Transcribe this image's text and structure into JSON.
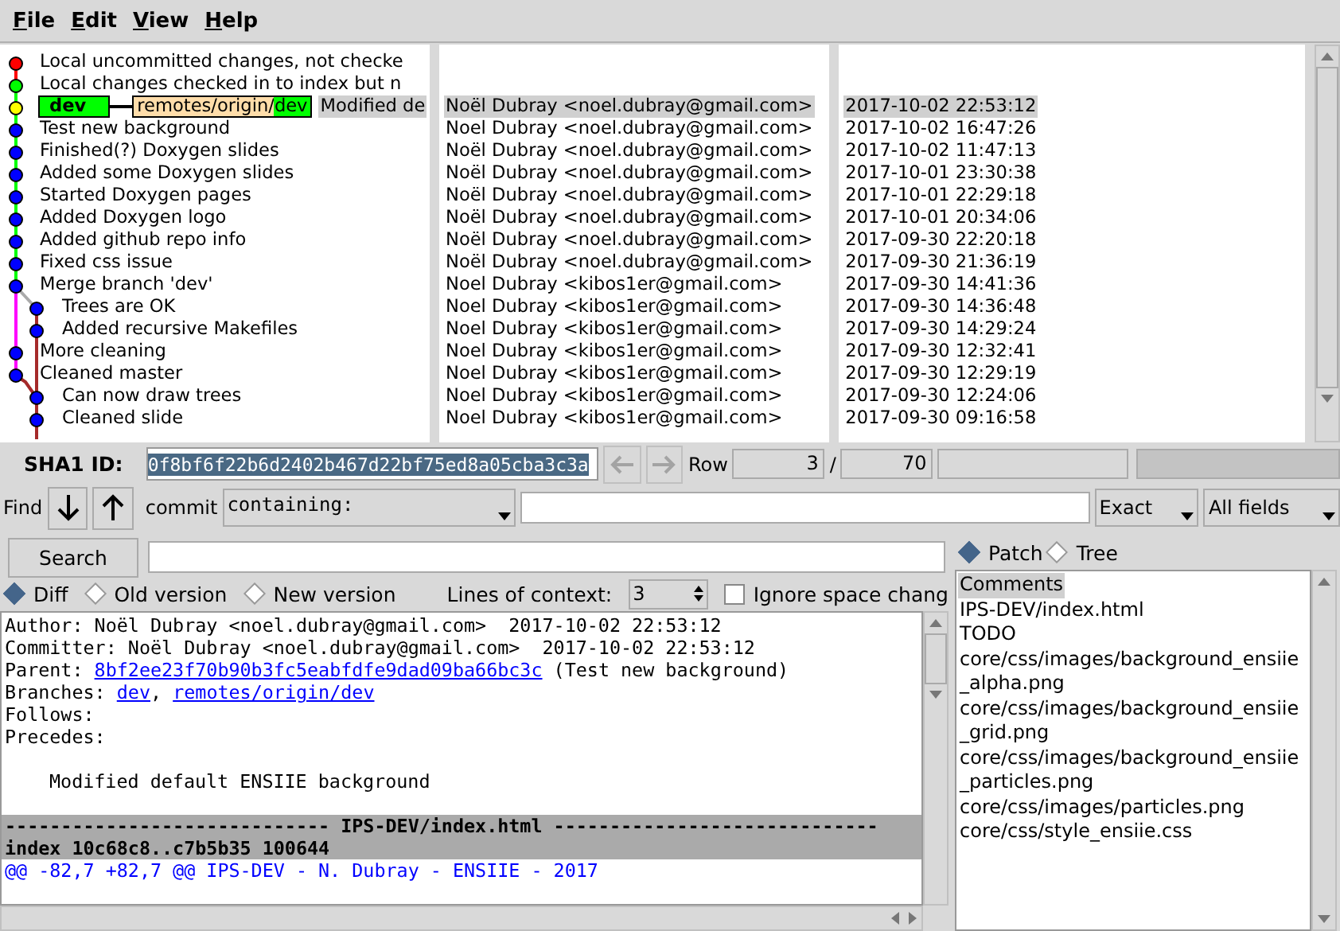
{
  "menu": [
    "File",
    "Edit",
    "View",
    "Help"
  ],
  "commits": [
    {
      "subject": "Local uncommitted changes, not checke",
      "color": "#ff0000",
      "kind": "main",
      "selected": false
    },
    {
      "subject": "Local changes checked in to index but n",
      "color": "#00ff00",
      "kind": "main",
      "selected": false
    },
    {
      "subject": "Modified de",
      "color": "#ffff00",
      "kind": "main",
      "selected": true,
      "refs": [
        {
          "kind": "local",
          "name": "dev"
        },
        {
          "kind": "remote",
          "prefix": "remotes/origin/",
          "name": "dev"
        }
      ],
      "author": "Noël Dubray <noel.dubray@gmail.com>",
      "date": "2017-10-02 22:53:12"
    },
    {
      "subject": "Test new background",
      "color": "#0000ff",
      "kind": "main",
      "selected": false,
      "author": "Noel Dubray <noel.dubray@gmail.com>",
      "date": "2017-10-02 16:47:26"
    },
    {
      "subject": "Finished(?) Doxygen slides",
      "color": "#0000ff",
      "kind": "main",
      "selected": false,
      "author": "Noël Dubray <noel.dubray@gmail.com>",
      "date": "2017-10-02 11:47:13"
    },
    {
      "subject": "Added some Doxygen slides",
      "color": "#0000ff",
      "kind": "main",
      "selected": false,
      "author": "Noël Dubray <noel.dubray@gmail.com>",
      "date": "2017-10-01 23:30:38"
    },
    {
      "subject": "Started Doxygen pages",
      "color": "#0000ff",
      "kind": "main",
      "selected": false,
      "author": "Noël Dubray <noel.dubray@gmail.com>",
      "date": "2017-10-01 22:29:18"
    },
    {
      "subject": "Added Doxygen logo",
      "color": "#0000ff",
      "kind": "main",
      "selected": false,
      "author": "Noël Dubray <noel.dubray@gmail.com>",
      "date": "2017-10-01 20:34:06"
    },
    {
      "subject": "Added github repo info",
      "color": "#0000ff",
      "kind": "main",
      "selected": false,
      "author": "Noël Dubray <noel.dubray@gmail.com>",
      "date": "2017-09-30 22:20:18"
    },
    {
      "subject": "Fixed css issue",
      "color": "#0000ff",
      "kind": "main",
      "selected": false,
      "author": "Noël Dubray <noel.dubray@gmail.com>",
      "date": "2017-09-30 21:36:19"
    },
    {
      "subject": "Merge branch 'dev'",
      "color": "#0000ff",
      "kind": "main",
      "selected": false,
      "author": "Noel Dubray <kibos1er@gmail.com>",
      "date": "2017-09-30 14:41:36"
    },
    {
      "subject": "Trees are OK",
      "color": "#0000ff",
      "kind": "side",
      "selected": false,
      "author": "Noel Dubray <kibos1er@gmail.com>",
      "date": "2017-09-30 14:36:48"
    },
    {
      "subject": "Added recursive Makefiles",
      "color": "#0000ff",
      "kind": "side",
      "selected": false,
      "author": "Noel Dubray <kibos1er@gmail.com>",
      "date": "2017-09-30 14:29:24"
    },
    {
      "subject": "More cleaning",
      "color": "#0000ff",
      "kind": "main",
      "selected": false,
      "author": "Noel Dubray <kibos1er@gmail.com>",
      "date": "2017-09-30 12:32:41"
    },
    {
      "subject": "Cleaned master",
      "color": "#0000ff",
      "kind": "main",
      "selected": false,
      "author": "Noel Dubray <kibos1er@gmail.com>",
      "date": "2017-09-30 12:29:19"
    },
    {
      "subject": "Can now draw trees",
      "color": "#0000ff",
      "kind": "side",
      "selected": false,
      "author": "Noel Dubray <kibos1er@gmail.com>",
      "date": "2017-09-30 12:24:06"
    },
    {
      "subject": "Cleaned slide",
      "color": "#0000ff",
      "kind": "side",
      "selected": false,
      "author": "Noel Dubray <kibos1er@gmail.com>",
      "date": "2017-09-30 09:16:58"
    }
  ],
  "sha_bar": {
    "label": "SHA1 ID:",
    "value": "0f8bf6f22b6d2402b467d22bf75ed8a05cba3c3a",
    "back_disabled": true,
    "forward_disabled": true,
    "row_label": "Row",
    "row": "3",
    "separator": "/",
    "total": "70"
  },
  "find": {
    "label": "Find",
    "type_label": "commit",
    "mode": "containing:",
    "match": "Exact",
    "fields": "All fields"
  },
  "search": {
    "button": "Search"
  },
  "diff_modes": [
    {
      "label": "Diff",
      "selected": true
    },
    {
      "label": "Old version",
      "selected": false
    },
    {
      "label": "New version",
      "selected": false
    }
  ],
  "context": {
    "label": "Lines of context:",
    "value": "3"
  },
  "ignore_space": {
    "label": "Ignore space chang",
    "checked": false
  },
  "details": [
    {
      "kind": "text",
      "parts": [
        {
          "text": "Author: Noël Dubray <noel.dubray@gmail.com>  2017-10-02 22:53:12"
        }
      ]
    },
    {
      "kind": "text",
      "parts": [
        {
          "text": "Committer: Noël Dubray <noel.dubray@gmail.com>  2017-10-02 22:53:12"
        }
      ]
    },
    {
      "kind": "text",
      "parts": [
        {
          "text": "Parent: "
        },
        {
          "link": "8bf2ee23f70b90b3fc5eabfdfe9dad09ba66bc3c"
        },
        {
          "text": " (Test new background)"
        }
      ]
    },
    {
      "kind": "text",
      "parts": [
        {
          "text": "Branches: "
        },
        {
          "link": "dev"
        },
        {
          "text": ", "
        },
        {
          "link": "remotes/origin/dev"
        }
      ]
    },
    {
      "kind": "text",
      "parts": [
        {
          "text": "Follows:"
        }
      ]
    },
    {
      "kind": "text",
      "parts": [
        {
          "text": "Precedes:"
        }
      ]
    },
    {
      "kind": "message",
      "parts": [
        {
          "text": "Modified default ENSIIE background"
        }
      ]
    },
    {
      "kind": "file_header",
      "parts": [
        {
          "text": "----------------------------- IPS-DEV/index.html -----------------------------"
        }
      ]
    },
    {
      "kind": "file_header",
      "parts": [
        {
          "text": "index 10c68c8..c7b5b35 100644"
        }
      ]
    },
    {
      "kind": "hunk",
      "parts": [
        {
          "text": "@@ -82,7 +82,7 @@ IPS-DEV - N. Dubray - ENSIIE - 2017"
        }
      ]
    }
  ],
  "file_view": [
    {
      "label": "Patch",
      "selected": true
    },
    {
      "label": "Tree",
      "selected": false
    }
  ],
  "files": [
    {
      "name": "Comments",
      "selected": true
    },
    {
      "name": "IPS-DEV/index.html",
      "selected": false
    },
    {
      "name": "TODO",
      "selected": false
    },
    {
      "name": "core/css/images/background_ensiie_alpha.png",
      "selected": false
    },
    {
      "name": "core/css/images/background_ensiie_grid.png",
      "selected": false
    },
    {
      "name": "core/css/images/background_ensiie_particles.png",
      "selected": false
    },
    {
      "name": "core/css/images/particles.png",
      "selected": false
    },
    {
      "name": "core/css/style_ensiie.css",
      "selected": false
    }
  ]
}
